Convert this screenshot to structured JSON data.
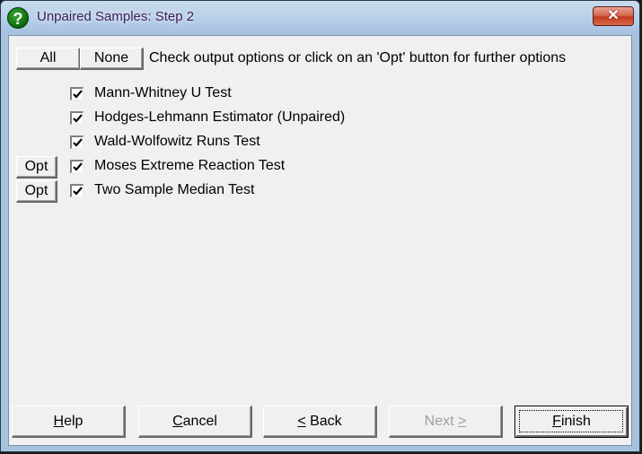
{
  "window": {
    "title": "Unpaired Samples: Step 2",
    "title_icon": "help-question-icon",
    "close_glyph": "✕"
  },
  "toolbar": {
    "all_label": "All",
    "none_label": "None",
    "instruction": "Check output options or click on an 'Opt' button for further options"
  },
  "options": [
    {
      "label": "Mann-Whitney U Test",
      "checked": true,
      "has_opt": false
    },
    {
      "label": "Hodges-Lehmann Estimator (Unpaired)",
      "checked": true,
      "has_opt": false
    },
    {
      "label": "Wald-Wolfowitz Runs Test",
      "checked": true,
      "has_opt": false
    },
    {
      "label": "Moses Extreme Reaction Test",
      "checked": true,
      "has_opt": true,
      "opt_label": "Opt"
    },
    {
      "label": "Two Sample Median Test",
      "checked": true,
      "has_opt": true,
      "opt_label": "Opt"
    }
  ],
  "footer": {
    "help": {
      "mnemonic": "H",
      "rest": "elp"
    },
    "cancel": {
      "mnemonic": "C",
      "rest": "ancel"
    },
    "back": {
      "mnemonic": "<",
      "rest": " Back"
    },
    "next": {
      "pre": "Next ",
      "mnemonic": ">",
      "disabled": true
    },
    "finish": {
      "mnemonic": "F",
      "rest": "inish"
    }
  }
}
